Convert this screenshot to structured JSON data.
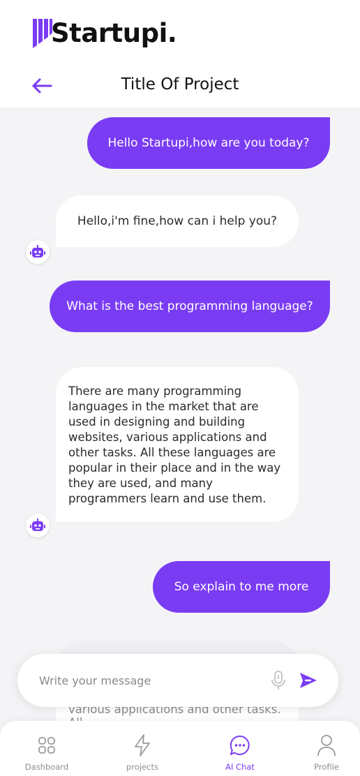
{
  "app": {
    "brand": "Startupi.",
    "accent_color": "#7a3cf3"
  },
  "header": {
    "title": "Title Of Project",
    "back_icon": "arrow-left-icon"
  },
  "messages": [
    {
      "role": "user",
      "text": "Hello Startupi,how are you today?"
    },
    {
      "role": "bot",
      "text": "Hello,i'm fine,how can i help you?"
    },
    {
      "role": "user",
      "text": "What is the best programming language?"
    },
    {
      "role": "bot",
      "text": "There are many programming languages in the market that are used in designing and building websites, various applications and other tasks. All these languages are popular in their place and in the way they are used, and many programmers learn and use them."
    },
    {
      "role": "user",
      "text": "So explain to me more"
    }
  ],
  "ghost_text": "various applications and other tasks. All",
  "composer": {
    "placeholder": "Write your message",
    "mic_icon": "microphone-icon",
    "send_icon": "send-icon"
  },
  "tabs": [
    {
      "label": "Dashboard",
      "icon": "grid-icon",
      "active": false
    },
    {
      "label": "projects",
      "icon": "lightning-icon",
      "active": false
    },
    {
      "label": "AI Chat",
      "icon": "chat-bubble-icon",
      "active": true
    },
    {
      "label": "Profile",
      "icon": "user-icon",
      "active": false
    }
  ]
}
